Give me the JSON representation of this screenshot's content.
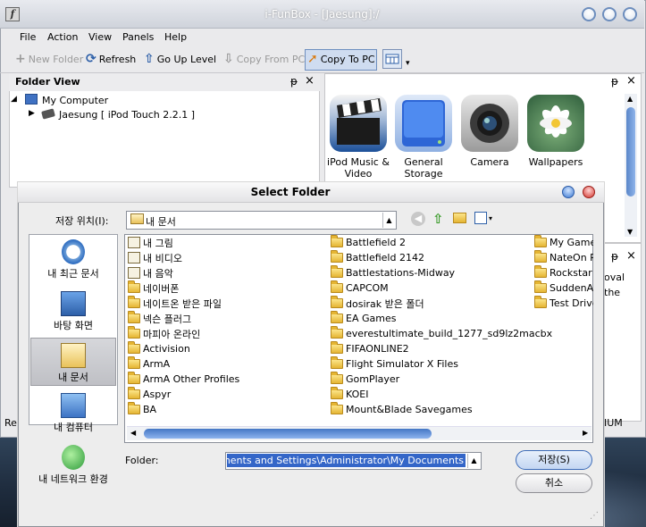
{
  "app": {
    "title": "i-FunBox - [Jaesung]:/",
    "menu": [
      "File",
      "Action",
      "View",
      "Panels",
      "Help"
    ],
    "toolbar": {
      "new_folder": "New Folder",
      "refresh": "Refresh",
      "go_up": "Go Up Level",
      "copy_from_pc": "Copy From PC",
      "copy_to_pc": "Copy To PC"
    }
  },
  "folder_view": {
    "title": "Folder View",
    "pin": "ᵽ",
    "close": "×",
    "tree": {
      "root": "My Computer",
      "device": "Jaesung [ iPod Touch 2.2.1 ]"
    }
  },
  "right_panel": {
    "pin": "ᵽ",
    "close": "×",
    "apps": [
      {
        "label": "iPod Music & Video",
        "icon": "clapperboard-icon"
      },
      {
        "label": "General Storage",
        "icon": "drive-icon"
      },
      {
        "label": "Camera",
        "icon": "camera-icon"
      },
      {
        "label": "Wallpapers",
        "icon": "lotus-icon"
      }
    ],
    "lower_pin": "ᵽ",
    "lower_close": "×",
    "peek_texts": [
      "oval",
      "the"
    ],
    "left_peek": "Rea",
    "right_peek": "IUM"
  },
  "dialog": {
    "title": "Select Folder",
    "look_in_label": "저장 위치(I):",
    "look_in_value": "내 문서",
    "places": [
      {
        "label": "내 최근 문서",
        "icon": "recent-documents-icon"
      },
      {
        "label": "바탕 화면",
        "icon": "desktop-icon"
      },
      {
        "label": "내 문서",
        "icon": "my-documents-icon"
      },
      {
        "label": "내 컴퓨터",
        "icon": "my-computer-icon"
      },
      {
        "label": "내 네트워크 환경",
        "icon": "network-icon"
      }
    ],
    "files_col1": [
      "내 그림",
      "내 비디오",
      "내 음악",
      "네이버폰",
      "네이트온 받은 파일",
      "넥슨 플러그",
      "마피아 온라인",
      "Activision",
      "ArmA",
      "ArmA Other Profiles",
      "Aspyr",
      "BA"
    ],
    "files_col2": [
      "Battlefield 2",
      "Battlefield 2142",
      "Battlestations-Midway",
      "CAPCOM",
      "dosirak 받은 폴더",
      "EA Games",
      "everestultimate_build_1277_sd9lz2macbx",
      "FIFAONLINE2",
      "Flight Simulator X Files",
      "GomPlayer",
      "KOEI",
      "Mount&Blade Savegames"
    ],
    "files_col3": [
      "My Games",
      "NateOn R",
      "Rockstar G",
      "SuddenAt",
      "Test Drive"
    ],
    "folder_label": "Folder:",
    "folder_value": "C:\\Documents and Settings\\Administrator\\My Documents",
    "save_label": "저장(S)",
    "cancel_label": "취소"
  }
}
